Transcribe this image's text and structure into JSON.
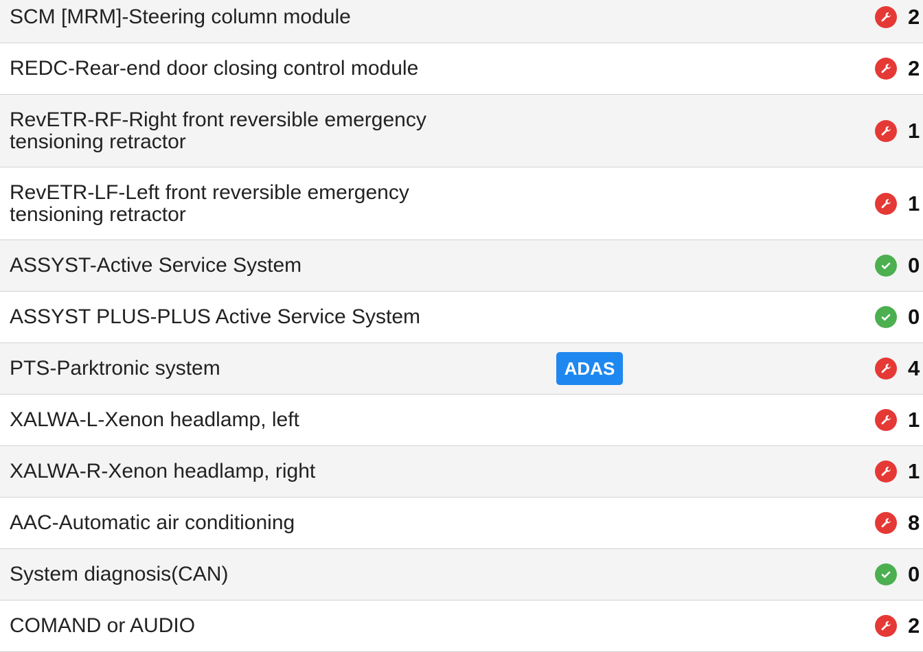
{
  "modules": [
    {
      "name": "SCM [MRM]-Steering column module",
      "status": "fault",
      "icon": "wrench-icon",
      "count": "2",
      "badge": null
    },
    {
      "name": "REDC-Rear-end door closing control module",
      "status": "fault",
      "icon": "wrench-icon",
      "count": "2",
      "badge": null
    },
    {
      "name": "RevETR-RF-Right front reversible emergency\ntensioning retractor",
      "status": "fault",
      "icon": "wrench-icon",
      "count": "1",
      "badge": null
    },
    {
      "name": "RevETR-LF-Left front reversible emergency\ntensioning retractor",
      "status": "fault",
      "icon": "wrench-icon",
      "count": "1",
      "badge": null
    },
    {
      "name": "ASSYST-Active Service System",
      "status": "ok",
      "icon": "check-icon",
      "count": "0",
      "badge": null
    },
    {
      "name": "ASSYST PLUS-PLUS Active Service System",
      "status": "ok",
      "icon": "check-icon",
      "count": "0",
      "badge": null
    },
    {
      "name": "PTS-Parktronic system",
      "status": "fault",
      "icon": "wrench-icon",
      "count": "4",
      "badge": "ADAS"
    },
    {
      "name": "XALWA-L-Xenon headlamp, left",
      "status": "fault",
      "icon": "wrench-icon",
      "count": "1",
      "badge": null
    },
    {
      "name": "XALWA-R-Xenon headlamp, right",
      "status": "fault",
      "icon": "wrench-icon",
      "count": "1",
      "badge": null
    },
    {
      "name": "AAC-Automatic air conditioning",
      "status": "fault",
      "icon": "wrench-icon",
      "count": "8",
      "badge": null
    },
    {
      "name": "System diagnosis(CAN)",
      "status": "ok",
      "icon": "check-icon",
      "count": "0",
      "badge": null
    },
    {
      "name": "COMAND or AUDIO",
      "status": "fault",
      "icon": "wrench-icon",
      "count": "2",
      "badge": null
    }
  ],
  "colors": {
    "fault": "#e53935",
    "ok": "#4caf50",
    "adas_badge": "#1e88f0"
  }
}
